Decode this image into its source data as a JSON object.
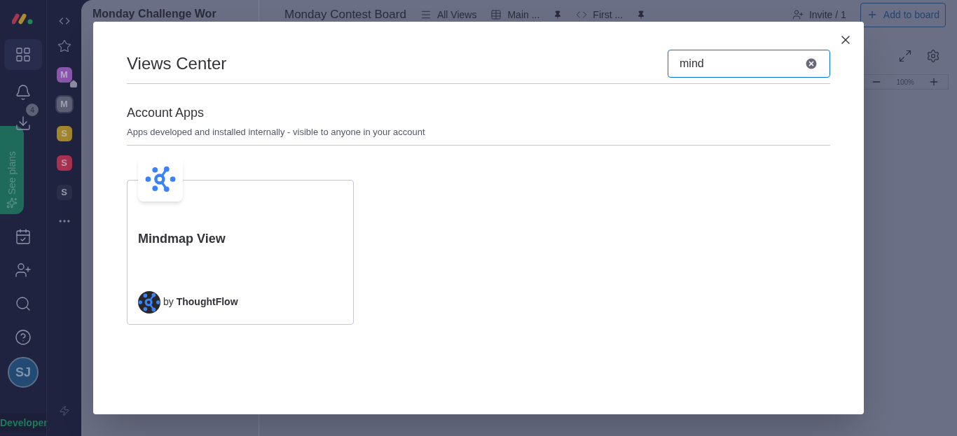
{
  "rail": {
    "badge": "4",
    "see_plans": "See plans",
    "avatar": "SJ",
    "footer": "Developer"
  },
  "workspaces": [
    {
      "letter": "M",
      "color": "#8a55ad",
      "selected": false,
      "home": true
    },
    {
      "letter": "M",
      "color": "#5d6075",
      "selected": true,
      "home": false
    },
    {
      "letter": "S",
      "color": "#a2862c",
      "selected": false,
      "home": false
    },
    {
      "letter": "S",
      "color": "#a8324f",
      "selected": false,
      "home": false
    },
    {
      "letter": "S",
      "color": "#2a2e48",
      "selected": false,
      "home": false
    }
  ],
  "workspace_panel": {
    "title": "Monday Challenge Wor"
  },
  "board": {
    "title": "Monday Contest Board",
    "views": [
      {
        "label": "All Views",
        "kind": "menu"
      },
      {
        "label": "Main ...",
        "kind": "table"
      },
      {
        "label": "First ...",
        "kind": "code"
      }
    ],
    "invite": "Invite / 1",
    "add": "Add to board",
    "zoom": "100%"
  },
  "modal": {
    "title": "Views Center",
    "search": {
      "value": "mind"
    },
    "section": {
      "title": "Account Apps",
      "subtitle": "Apps developed and installed internally - visible to anyone in your account"
    },
    "apps": [
      {
        "name": "Mindmap View",
        "by": "by",
        "vendor": "ThoughtFlow"
      }
    ]
  }
}
